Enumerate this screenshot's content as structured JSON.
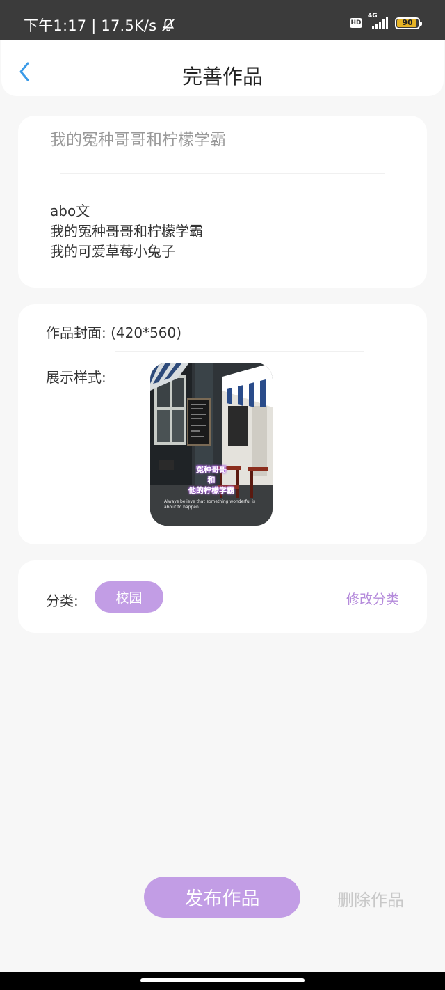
{
  "status_bar": {
    "time_speed": "下午1:17 | 17.5K/s",
    "hd_label": "HD",
    "network_label": "4G",
    "battery_level": "90",
    "battery_color": "#e6b325"
  },
  "nav": {
    "back_icon": "chevron-left-icon",
    "title": "完善作品"
  },
  "work": {
    "title_placeholder": "我的冤种哥哥和柠檬学霸",
    "description": "abo文\n我的冤种哥哥和柠檬学霸\n我的可爱草莓小兔子"
  },
  "cover": {
    "label": "作品封面: (420*560)",
    "style_label": "展示样式:",
    "image_text_line1": "冤种哥哥",
    "image_text_line2": "和",
    "image_text_line3": "他的柠檬学霸",
    "image_caption": "Always believe that something wonderful is about to happen"
  },
  "category": {
    "label": "分类:",
    "selected": "校园",
    "modify_label": "修改分类"
  },
  "actions": {
    "publish_label": "发布作品",
    "delete_label": "删除作品"
  },
  "colors": {
    "accent": "#c29de5",
    "link": "#b58bdb",
    "back_icon": "#3b9be8"
  }
}
